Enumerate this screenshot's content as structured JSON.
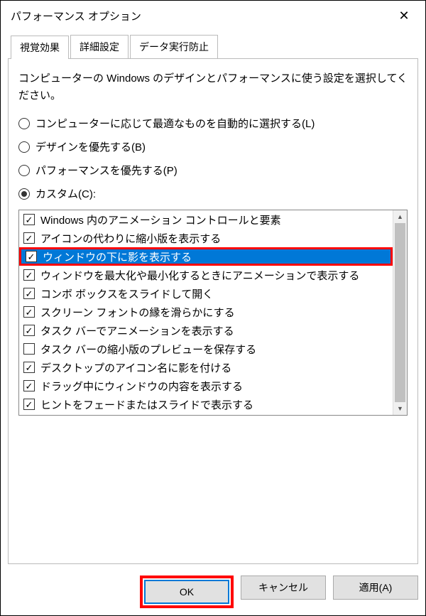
{
  "title": "パフォーマンス オプション",
  "tabs": [
    {
      "label": "視覚効果",
      "active": true
    },
    {
      "label": "詳細設定",
      "active": false
    },
    {
      "label": "データ実行防止",
      "active": false
    }
  ],
  "description": "コンピューターの Windows のデザインとパフォーマンスに使う設定を選択してください。",
  "radios": [
    {
      "label": "コンピューターに応じて最適なものを自動的に選択する(L)",
      "checked": false
    },
    {
      "label": "デザインを優先する(B)",
      "checked": false
    },
    {
      "label": "パフォーマンスを優先する(P)",
      "checked": false
    },
    {
      "label": "カスタム(C):",
      "checked": true
    }
  ],
  "items": [
    {
      "label": "Windows 内のアニメーション コントロールと要素",
      "checked": true,
      "selected": false
    },
    {
      "label": "アイコンの代わりに縮小版を表示する",
      "checked": true,
      "selected": false
    },
    {
      "label": "ウィンドウの下に影を表示する",
      "checked": true,
      "selected": true
    },
    {
      "label": "ウィンドウを最大化や最小化するときにアニメーションで表示する",
      "checked": true,
      "selected": false
    },
    {
      "label": "コンボ ボックスをスライドして開く",
      "checked": true,
      "selected": false
    },
    {
      "label": "スクリーン フォントの縁を滑らかにする",
      "checked": true,
      "selected": false
    },
    {
      "label": "タスク バーでアニメーションを表示する",
      "checked": true,
      "selected": false
    },
    {
      "label": "タスク バーの縮小版のプレビューを保存する",
      "checked": false,
      "selected": false
    },
    {
      "label": "デスクトップのアイコン名に影を付ける",
      "checked": true,
      "selected": false
    },
    {
      "label": "ドラッグ中にウィンドウの内容を表示する",
      "checked": true,
      "selected": false
    },
    {
      "label": "ヒントをフェードまたはスライドで表示する",
      "checked": true,
      "selected": false
    }
  ],
  "buttons": {
    "ok": "OK",
    "cancel": "キャンセル",
    "apply": "適用(A)"
  }
}
